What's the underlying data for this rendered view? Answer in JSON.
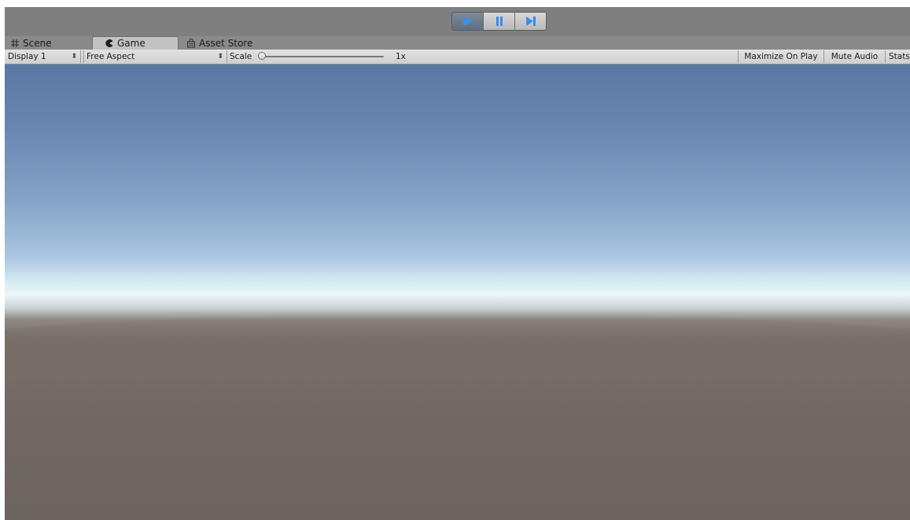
{
  "playbar": {
    "play_active": true,
    "icons": [
      "play-icon",
      "pause-icon",
      "step-icon"
    ]
  },
  "tabs": [
    {
      "label": "Scene",
      "icon": "scene-grid-icon",
      "active": false
    },
    {
      "label": "Game",
      "icon": "game-pacman-icon",
      "active": true
    },
    {
      "label": "Asset Store",
      "icon": "store-bag-icon",
      "active": false
    }
  ],
  "control_bar": {
    "display": "Display 1",
    "aspect": "Free Aspect",
    "scale_label": "Scale",
    "scale_value": "1x",
    "maximize": "Maximize On Play",
    "mute": "Mute Audio",
    "stats": "Stats"
  },
  "colors": {
    "sky_top": "#5a76a2",
    "horizon": "#eef8fa",
    "ground": "#6c6460",
    "accent_play": "#3a8ee6"
  }
}
